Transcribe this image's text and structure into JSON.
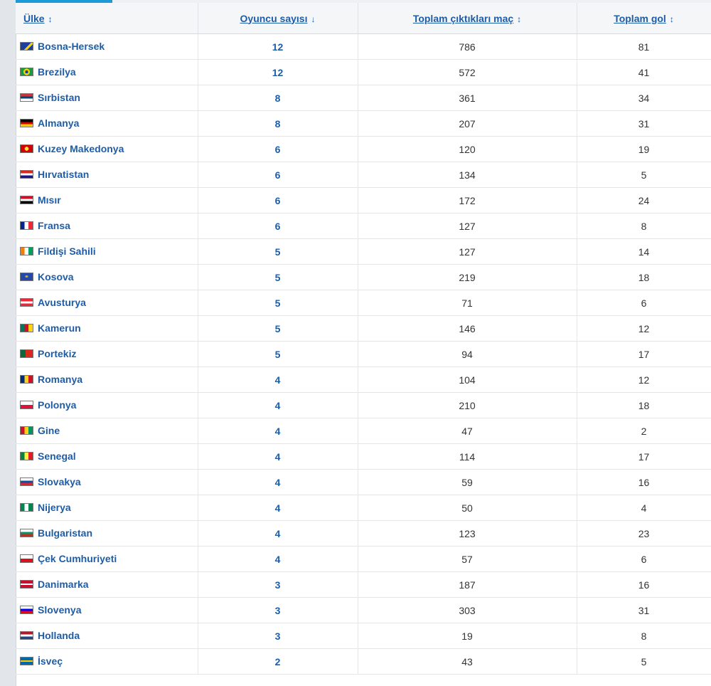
{
  "columns": {
    "country": "Ülke",
    "players": "Oyuncu sayısı",
    "matches": "Toplam çıktıkları maç",
    "goals": "Toplam gol"
  },
  "rows": [
    {
      "country": "Bosna-Hersek",
      "players": "12",
      "matches": "786",
      "goals": "81",
      "flag": "linear-gradient(135deg,#1b3f9a 0 55%,#f7d117 55% 72%,#1b3f9a 72%)"
    },
    {
      "country": "Brezilya",
      "players": "12",
      "matches": "572",
      "goals": "41",
      "flag": "radial-gradient(circle,#1f3e8f 0 22%,#f5d400 23% 45%,#1c9a3a 46%)"
    },
    {
      "country": "Sırbistan",
      "players": "8",
      "matches": "361",
      "goals": "34",
      "flag": "linear-gradient(#c6363c 0 33%,#0c4076 33% 66%,#ffffff 66%)"
    },
    {
      "country": "Almanya",
      "players": "8",
      "matches": "207",
      "goals": "31",
      "flag": "linear-gradient(#000000 0 33%,#dd0000 33% 66%,#ffce00 66%)"
    },
    {
      "country": "Kuzey Makedonya",
      "players": "6",
      "matches": "120",
      "goals": "19",
      "flag": "radial-gradient(circle,#f8e92e 0 28%,#d20000 29%)"
    },
    {
      "country": "Hırvatistan",
      "players": "6",
      "matches": "134",
      "goals": "5",
      "flag": "linear-gradient(#d52b1e 0 33%,#ffffff 33% 66%,#171796 66%)"
    },
    {
      "country": "Mısır",
      "players": "6",
      "matches": "172",
      "goals": "24",
      "flag": "linear-gradient(#ce1126 0 33%,#ffffff 33% 66%,#000000 66%)"
    },
    {
      "country": "Fransa",
      "players": "6",
      "matches": "127",
      "goals": "8",
      "flag": "linear-gradient(90deg,#002395 0 33%,#ffffff 33% 66%,#ed2939 66%)"
    },
    {
      "country": "Fildişi Sahili",
      "players": "5",
      "matches": "127",
      "goals": "14",
      "flag": "linear-gradient(90deg,#f77f00 0 33%,#ffffff 33% 66%,#009e60 66%)"
    },
    {
      "country": "Kosova",
      "players": "5",
      "matches": "219",
      "goals": "18",
      "flag": "radial-gradient(ellipse at 50% 45%,#d0a650 0 18%,#244aa5 19%)"
    },
    {
      "country": "Avusturya",
      "players": "5",
      "matches": "71",
      "goals": "6",
      "flag": "linear-gradient(#ed2939 0 33%,#ffffff 33% 66%,#ed2939 66%)"
    },
    {
      "country": "Kamerun",
      "players": "5",
      "matches": "146",
      "goals": "12",
      "flag": "linear-gradient(90deg,#007a5e 0 33%,#ce1126 33% 66%,#fcd116 66%)"
    },
    {
      "country": "Portekiz",
      "players": "5",
      "matches": "94",
      "goals": "17",
      "flag": "linear-gradient(90deg,#046a38 0 40%,#da291c 40%)"
    },
    {
      "country": "Romanya",
      "players": "4",
      "matches": "104",
      "goals": "12",
      "flag": "linear-gradient(90deg,#002b7f 0 33%,#fcd116 33% 66%,#ce1126 66%)"
    },
    {
      "country": "Polonya",
      "players": "4",
      "matches": "210",
      "goals": "18",
      "flag": "linear-gradient(#ffffff 0 50%,#dc143c 50%)"
    },
    {
      "country": "Gine",
      "players": "4",
      "matches": "47",
      "goals": "2",
      "flag": "linear-gradient(90deg,#ce1126 0 33%,#fcd116 33% 66%,#009460 66%)"
    },
    {
      "country": "Senegal",
      "players": "4",
      "matches": "114",
      "goals": "17",
      "flag": "linear-gradient(90deg,#00853f 0 33%,#fdef42 33% 66%,#e31b23 66%)"
    },
    {
      "country": "Slovakya",
      "players": "4",
      "matches": "59",
      "goals": "16",
      "flag": "linear-gradient(#ffffff 0 33%,#0b4ea2 33% 66%,#ee1c25 66%)"
    },
    {
      "country": "Nijerya",
      "players": "4",
      "matches": "50",
      "goals": "4",
      "flag": "linear-gradient(90deg,#008751 0 33%,#ffffff 33% 66%,#008751 66%)"
    },
    {
      "country": "Bulgaristan",
      "players": "4",
      "matches": "123",
      "goals": "23",
      "flag": "linear-gradient(#ffffff 0 33%,#00966e 33% 66%,#d62612 66%)"
    },
    {
      "country": "Çek Cumhuriyeti",
      "players": "4",
      "matches": "57",
      "goals": "6",
      "flag": "linear-gradient(#ffffff 0 50%,#d7141a 50%)"
    },
    {
      "country": "Danimarka",
      "players": "3",
      "matches": "187",
      "goals": "16",
      "flag": "linear-gradient(#c8102e 0 40%,#ffffff 40% 60%,#c8102e 60%)"
    },
    {
      "country": "Slovenya",
      "players": "3",
      "matches": "303",
      "goals": "31",
      "flag": "linear-gradient(#ffffff 0 33%,#0000ff 33% 66%,#ff0000 66%)"
    },
    {
      "country": "Hollanda",
      "players": "3",
      "matches": "19",
      "goals": "8",
      "flag": "linear-gradient(#ae1c28 0 33%,#ffffff 33% 66%,#21468b 66%)"
    },
    {
      "country": "İsveç",
      "players": "2",
      "matches": "43",
      "goals": "5",
      "flag": "linear-gradient(#006aa7 0 40%,#fecc00 40% 60%,#006aa7 60%)"
    }
  ]
}
